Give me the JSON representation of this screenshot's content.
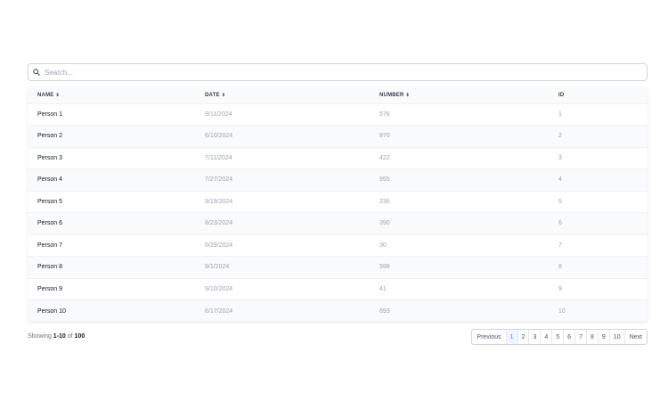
{
  "search": {
    "placeholder": "Search..."
  },
  "table": {
    "headers": {
      "name": "NAME",
      "date": "DATE",
      "number": "NUMBER",
      "id": "ID"
    },
    "sort_glyph": "⇕",
    "rows": [
      {
        "name": "Person 1",
        "date": "9/11/2024",
        "number": "576",
        "id": "1"
      },
      {
        "name": "Person 2",
        "date": "6/10/2024",
        "number": "870",
        "id": "2"
      },
      {
        "name": "Person 3",
        "date": "7/11/2024",
        "number": "422",
        "id": "3"
      },
      {
        "name": "Person 4",
        "date": "7/27/2024",
        "number": "955",
        "id": "4"
      },
      {
        "name": "Person 5",
        "date": "9/19/2024",
        "number": "236",
        "id": "5"
      },
      {
        "name": "Person 6",
        "date": "8/23/2024",
        "number": "390",
        "id": "6"
      },
      {
        "name": "Person 7",
        "date": "6/29/2024",
        "number": "30",
        "id": "7"
      },
      {
        "name": "Person 8",
        "date": "9/1/2024",
        "number": "598",
        "id": "8"
      },
      {
        "name": "Person 9",
        "date": "9/10/2024",
        "number": "41",
        "id": "9"
      },
      {
        "name": "Person 10",
        "date": "6/17/2024",
        "number": "693",
        "id": "10"
      }
    ]
  },
  "footer": {
    "showing_prefix": "Showing ",
    "range": "1-10",
    "of_text": " of ",
    "total": "100"
  },
  "pagination": {
    "previous": "Previous",
    "pages": [
      "1",
      "2",
      "3",
      "4",
      "5",
      "6",
      "7",
      "8",
      "9",
      "10"
    ],
    "next": "Next",
    "current": "1"
  },
  "colors": {
    "accent": "#3b82f6",
    "active_page_bg": "#eff6ff",
    "stripe": "#f9fafb"
  }
}
